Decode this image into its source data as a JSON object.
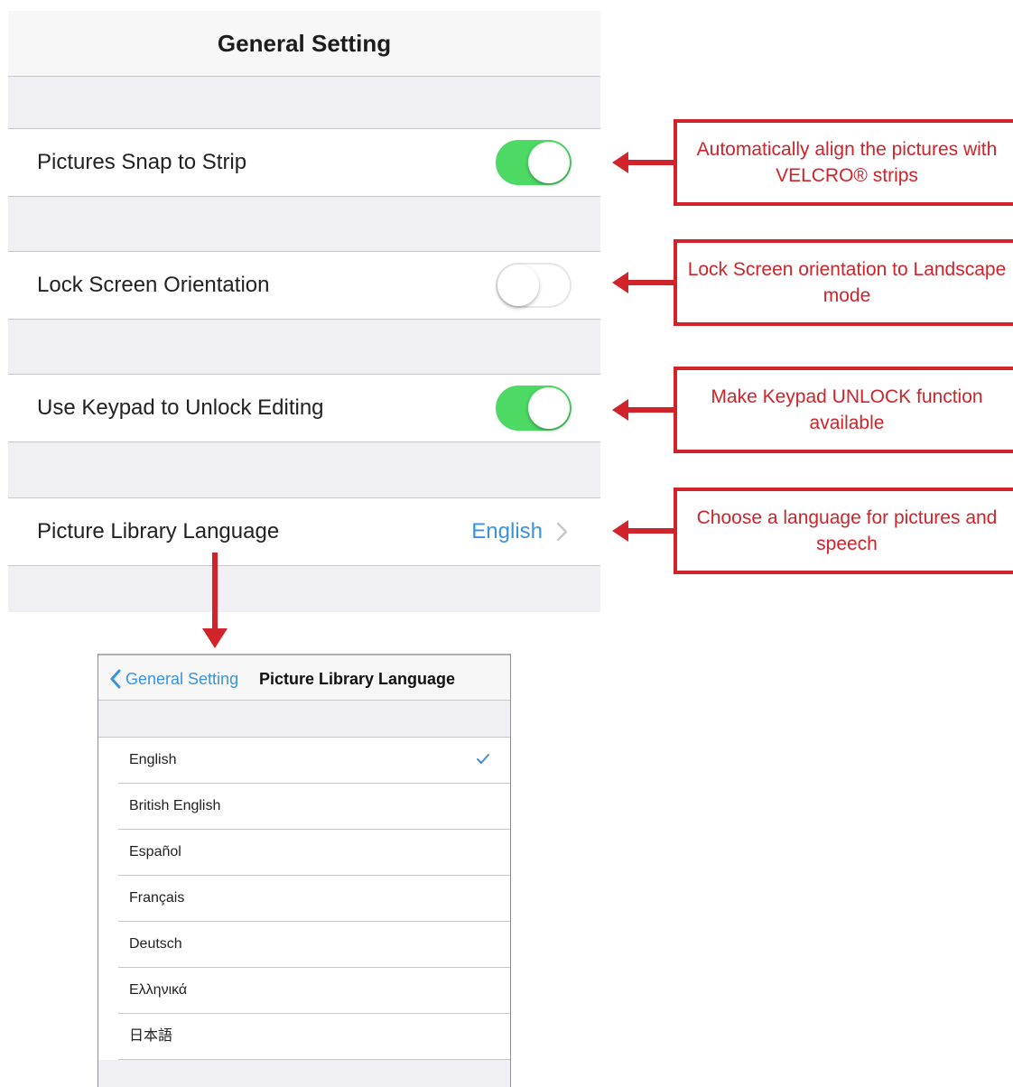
{
  "settings": {
    "title": "General Setting",
    "rows": [
      {
        "label": "Pictures Snap to Strip",
        "toggle": true
      },
      {
        "label": "Lock Screen Orientation",
        "toggle": false
      },
      {
        "label": "Use Keypad to Unlock Editing",
        "toggle": true
      },
      {
        "label": "Picture Library Language",
        "value": "English"
      }
    ]
  },
  "callouts": [
    "Automatically align the pictures with VELCRO® strips",
    "Lock Screen orientation to Landscape mode",
    "Make Keypad UNLOCK function available",
    "Choose a language for pictures and speech"
  ],
  "language_screen": {
    "back_label": "General Setting",
    "title": "Picture Library Language",
    "selected": "English",
    "languages": [
      "English",
      "British English",
      "Español",
      "Français",
      "Deutsch",
      "Ελληνικά",
      "日本語"
    ]
  },
  "colors": {
    "accent": "#3a93e0",
    "toggle_on": "#4cd964",
    "annotation": "#d0232a"
  }
}
